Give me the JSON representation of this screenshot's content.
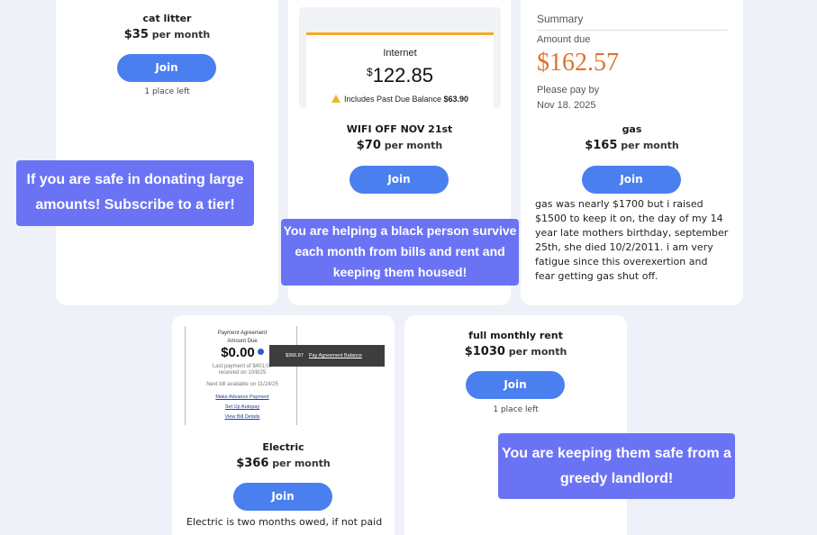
{
  "colors": {
    "page_bg": "#eef1f8",
    "join_button": "#4a7ff0",
    "banner": "#6b73f5",
    "amount_orange": "#e0722a"
  },
  "cards": {
    "cat_litter": {
      "title": "cat litter",
      "amount": "$35",
      "per": "per month",
      "join": "Join",
      "left_note": "1 place left"
    },
    "internet": {
      "image": {
        "label": "Internet",
        "currency": "$",
        "amount": "122.85",
        "past_due_label": "Includes Past Due Balance",
        "past_due_amount": "$63.90"
      },
      "title": "WIFI OFF NOV 21st",
      "amount": "$70",
      "per": "per month",
      "join": "Join"
    },
    "gas": {
      "image": {
        "heading": "Summary",
        "amount_label": "Amount due",
        "amount": "$162.57",
        "please_pay": "Please pay by",
        "due_date": "Nov 18, 2025"
      },
      "title": "gas",
      "amount": "$165",
      "per": "per month",
      "join": "Join",
      "description": "gas was nearly $1700 but i raised $1500 to keep it on, the day of my 14 year late mothers birthday, september 25th, she died 10/2/2011. i am very fatigue since this overexertion and fear getting gas shut off."
    },
    "electric": {
      "image": {
        "heading": "Payment Agreement",
        "amount_label": "Amount Due",
        "amount": "$0.00",
        "last_payment": "Last payment of $401.00",
        "received": "received on 10/8/25",
        "next_bill": "Next bill available on 11/24/25",
        "tooltip_amount": "$366.87",
        "tooltip_link": "Pay Agreement Balance",
        "links": [
          "Make Advance Payment",
          "Set Up Autopay",
          "View Bill Details"
        ]
      },
      "title": "Electric",
      "amount": "$366",
      "per": "per month",
      "join": "Join",
      "description": "Electric is two months owed, if not paid"
    },
    "rent": {
      "title": "full monthly rent",
      "amount": "$1030",
      "per": "per month",
      "join": "Join",
      "left_note": "1 place left"
    }
  },
  "banners": {
    "donate": "If you are safe in donating large amounts! Subscribe to a tier!",
    "helping": "You are helping a black person survive each month from bills and rent and keeping them housed!",
    "landlord": "You are keeping them safe from a greedy landlord!"
  }
}
